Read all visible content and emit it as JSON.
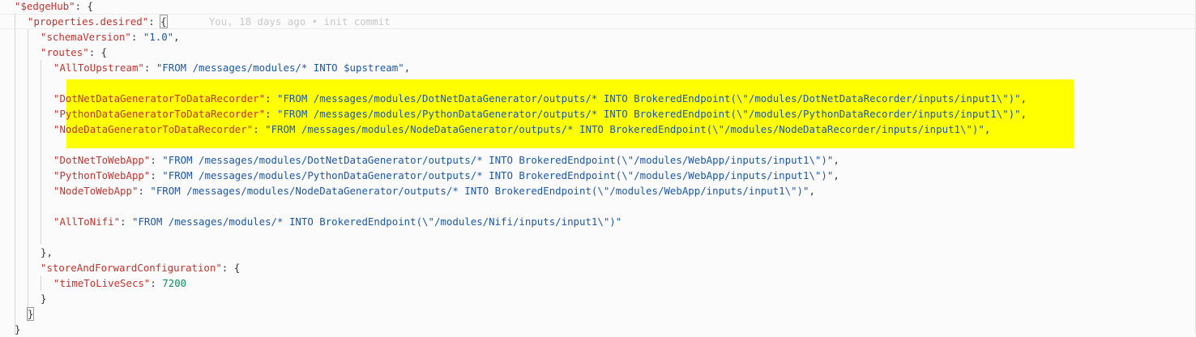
{
  "editor": {
    "blame": "You, 18 days ago • init commit",
    "lines": [
      {
        "key": "\"$edgeHub\"",
        "after": ": {"
      },
      {
        "key": "\"properties.desired\"",
        "after": ": ",
        "brace": "{"
      },
      {
        "key": "\"schemaVersion\"",
        "after": ": ",
        "str": "\"1.0\"",
        "tail": ","
      },
      {
        "key": "\"routes\"",
        "after": ": {"
      },
      {
        "key": "\"AllToUpstream\"",
        "after": ": ",
        "str": "\"FROM /messages/modules/* INTO $upstream\"",
        "tail": ","
      },
      {
        "key": "\"DotNetDataGeneratorToDataRecorder\"",
        "after": ": ",
        "str": "\"FROM /messages/modules/DotNetDataGenerator/outputs/* INTO BrokeredEndpoint(\\\"/modules/DotNetDataRecorder/inputs/input1\\\")\"",
        "tail": ","
      },
      {
        "key": "\"PythonDataGeneratorToDataRecorder\"",
        "after": ": ",
        "str": "\"FROM /messages/modules/PythonDataGenerator/outputs/* INTO BrokeredEndpoint(\\\"/modules/PythonDataRecorder/inputs/input1\\\")\"",
        "tail": ","
      },
      {
        "key": "\"NodeDataGeneratorToDataRecorder\"",
        "after": ": ",
        "str": "\"FROM /messages/modules/NodeDataGenerator/outputs/* INTO BrokeredEndpoint(\\\"/modules/NodeDataRecorder/inputs/input1\\\")\"",
        "tail": ","
      },
      {
        "key": "\"DotNetToWebApp\"",
        "after": ": ",
        "str": "\"FROM /messages/modules/DotNetDataGenerator/outputs/* INTO BrokeredEndpoint(\\\"/modules/WebApp/inputs/input1\\\")\"",
        "tail": ","
      },
      {
        "key": "\"PythonToWebApp\"",
        "after": ": ",
        "str": "\"FROM /messages/modules/PythonDataGenerator/outputs/* INTO BrokeredEndpoint(\\\"/modules/WebApp/inputs/input1\\\")\"",
        "tail": ","
      },
      {
        "key": "\"NodeToWebApp\"",
        "after": ": ",
        "str": "\"FROM /messages/modules/NodeDataGenerator/outputs/* INTO BrokeredEndpoint(\\\"/modules/WebApp/inputs/input1\\\")\"",
        "tail": ","
      },
      {
        "key": "\"AllToNifi\"",
        "after": ": ",
        "str": "\"FROM /messages/modules/* INTO BrokeredEndpoint(\\\"/modules/Nifi/inputs/input1\\\")\""
      },
      {
        "text": "},"
      },
      {
        "key": "\"storeAndForwardConfiguration\"",
        "after": ": {"
      },
      {
        "key": "\"timeToLiveSecs\"",
        "after": ": ",
        "num": "7200"
      },
      {
        "text": "}"
      },
      {
        "text": "}"
      },
      {
        "text": "}"
      }
    ]
  }
}
